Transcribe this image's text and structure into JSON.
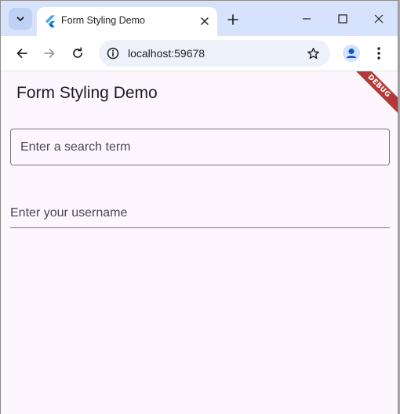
{
  "browser": {
    "tab_title": "Form Styling Demo",
    "url": "localhost:59678",
    "icons": {
      "tab_search": "chevron-down-icon",
      "favicon": "flutter-icon",
      "tab_close": "close-icon",
      "new_tab": "plus-icon",
      "minimize": "minimize-icon",
      "maximize": "maximize-icon",
      "close_window": "close-icon",
      "back": "arrow-left-icon",
      "forward": "arrow-right-icon",
      "reload": "reload-icon",
      "site_info": "info-icon",
      "bookmark": "star-icon",
      "profile": "avatar-icon",
      "menu": "kebab-menu-icon"
    }
  },
  "app": {
    "title": "Form Styling Demo",
    "debug_banner": "DEBUG",
    "search_field": {
      "placeholder": "Enter a search term",
      "value": ""
    },
    "username_field": {
      "placeholder": "Enter your username",
      "value": ""
    }
  },
  "colors": {
    "tab_strip": "#d7e3fc",
    "page_background": "#fdf6fe",
    "field_border": "#79747e",
    "debug_banner": "#b13a38",
    "profile_accent": "#0b57d0"
  }
}
